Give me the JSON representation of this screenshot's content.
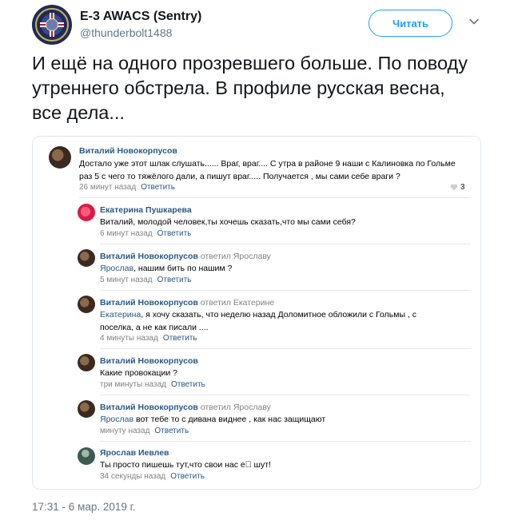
{
  "tweet": {
    "display_name": "E-3 AWACS (Sentry)",
    "handle": "@thunderbolt1488",
    "follow_label": "Читать",
    "text": "И ещё на одного прозревшего больше. По поводу утреннего обстрела. В профиле русская весна, все дела...",
    "timestamp": "17:31 - 6 мар. 2019 г.",
    "accent_color": "#1da1f2"
  },
  "comments": [
    {
      "author": "Виталий Новокорпусов",
      "reply_to": "",
      "mention": "",
      "text": "Достало уже этот шлак слушать...... Враг, враг.... С утра в районе 9 наши с Калиновка по Гольме раз 5 с чего то тяжёлого дали, а пишут враг..... Получается , мы сами себе враги ?",
      "time": "26 минут назад",
      "reply_label": "Ответить",
      "likes": "3"
    },
    {
      "author": "Екатерина Пушкарева",
      "reply_to": "",
      "mention": "",
      "text": "Виталий, молодой человек,ты хочешь сказать,что мы сами себя?",
      "time": "6 минут назад",
      "reply_label": "Ответить"
    },
    {
      "author": "Виталий Новокорпусов",
      "reply_to": "ответил Ярославу",
      "mention": "Ярослав",
      "text": ", нашим бить по нашим ?",
      "time": "5 минут назад",
      "reply_label": "Ответить"
    },
    {
      "author": "Виталий Новокорпусов",
      "reply_to": "ответил Екатерине",
      "mention": "Екатерина",
      "text": ", я хочу сказать, что неделю назад Доломитное обложили с Гольмы , с поселка, а не как писали ....",
      "time": "4 минуты назад",
      "reply_label": "Ответить"
    },
    {
      "author": "Виталий Новокорпусов",
      "reply_to": "",
      "mention": "",
      "text": "Какие провокации ?",
      "time": "три минуты назад",
      "reply_label": "Ответить"
    },
    {
      "author": "Виталий Новокорпусов",
      "reply_to": "ответил Ярославу",
      "mention": "Ярослав",
      "text": " вот тебе то с дивана виднее , как нас защищают",
      "time": "минуту назад",
      "reply_label": "Ответить"
    },
    {
      "author": "Ярослав Иевлев",
      "reply_to": "",
      "mention": "",
      "text": "Ты просто пишешь тут,что свои нас е\u0000   шут!",
      "time": "34 секунды назад",
      "reply_label": "Ответить"
    }
  ]
}
